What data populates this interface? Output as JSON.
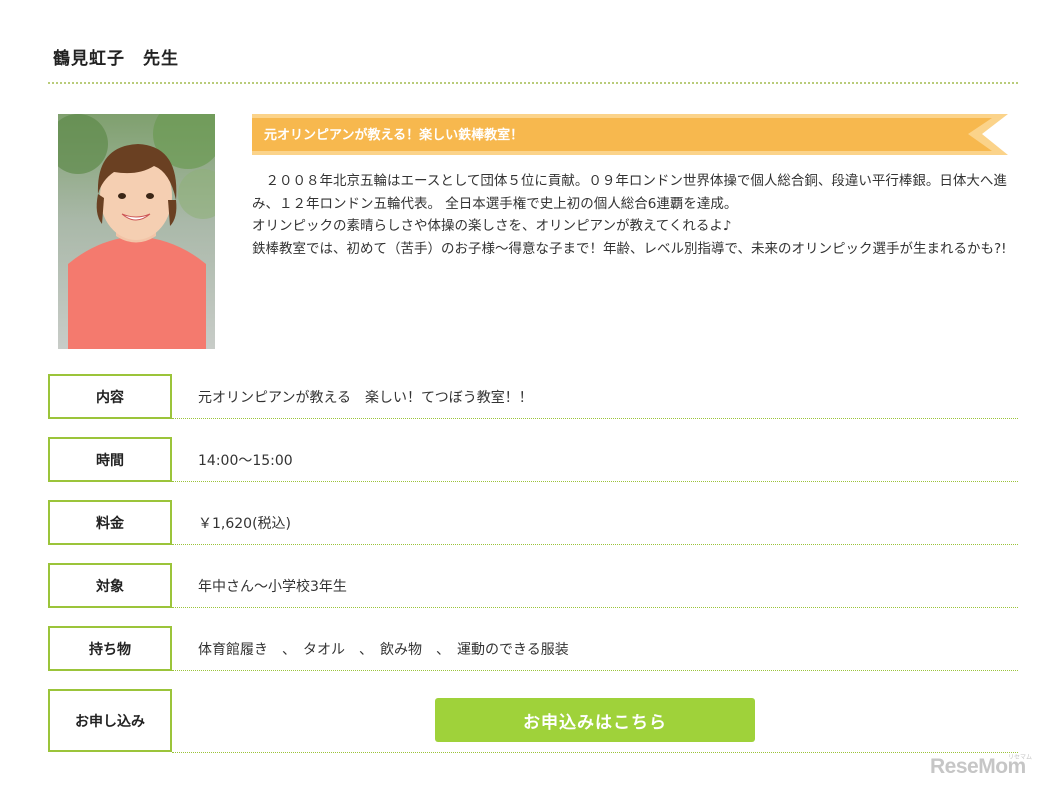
{
  "teacher": {
    "name": "鶴見虹子　先生"
  },
  "profile": {
    "banner": "元オリンピアンが教える！楽しい鉄棒教室！",
    "description": [
      "　２００８年北京五輪はエースとして団体５位に貢献。０９年ロンドン世界体操で個人総合銅、段違い平行棒銀。日体大へ進み、１２年ロンドン五輪代表。 全日本選手権で史上初の個人総合6連覇を達成。",
      "オリンピックの素晴らしさや体操の楽しさを、オリンピアンが教えてくれるよ♪",
      "鉄棒教室では、初めて（苦手）のお子様〜得意な子まで！年齢、レベル別指導で、未来のオリンピック選手が生まれるかも?!"
    ],
    "colors": {
      "banner": "#f7b84e",
      "banner_light": "#fbd38a",
      "accent_green": "#9bc43a",
      "button_green": "#9fd23a"
    }
  },
  "details": {
    "content": {
      "label": "内容",
      "value": "元オリンピアンが教える　楽しい！てつぼう教室！！"
    },
    "time": {
      "label": "時間",
      "value": "14:00〜15:00"
    },
    "fee": {
      "label": "料金",
      "value": "￥1,620(税込)"
    },
    "target": {
      "label": "対象",
      "value": "年中さん〜小学校3年生"
    },
    "items": {
      "label": "持ち物",
      "value": "体育館履き　、　タオル　、　飲み物　、　運動のできる服装"
    },
    "apply": {
      "label": "お申し込み",
      "button": "お申込みはこちら"
    }
  },
  "watermark": {
    "text": "ReseMom",
    "small": "リセマム"
  }
}
